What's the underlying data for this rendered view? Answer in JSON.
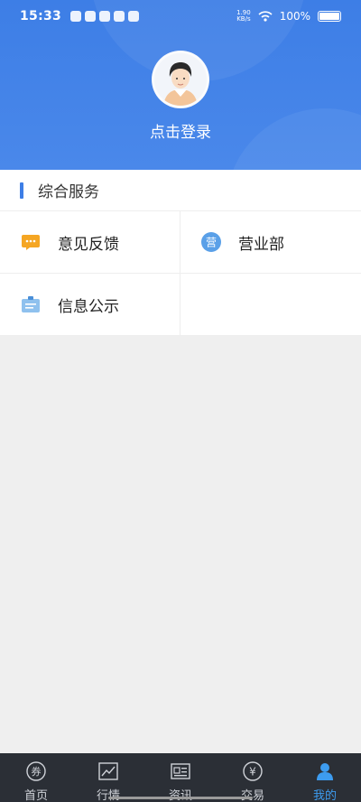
{
  "status_bar": {
    "time": "15:33",
    "net_speed_top": "1.90",
    "net_speed_bottom": "KB/s",
    "battery": "100%"
  },
  "profile": {
    "login_label": "点击登录"
  },
  "section": {
    "title": "综合服务",
    "items": [
      {
        "label": "意见反馈",
        "icon": "feedback-icon"
      },
      {
        "label": "营业部",
        "icon": "branch-icon",
        "icon_text": "营"
      },
      {
        "label": "信息公示",
        "icon": "notice-board-icon"
      }
    ]
  },
  "tabbar": {
    "tabs": [
      {
        "label": "首页",
        "icon": "home-coupon-icon",
        "icon_text": "券"
      },
      {
        "label": "行情",
        "icon": "chart-icon"
      },
      {
        "label": "资讯",
        "icon": "news-icon"
      },
      {
        "label": "交易",
        "icon": "yen-icon",
        "icon_text": "¥"
      },
      {
        "label": "我的",
        "icon": "user-icon"
      }
    ],
    "active_index": 4
  },
  "colors": {
    "accent": "#3d7ee6",
    "tab_active": "#3d9cf0",
    "tabbar_bg": "#2b2f36"
  }
}
